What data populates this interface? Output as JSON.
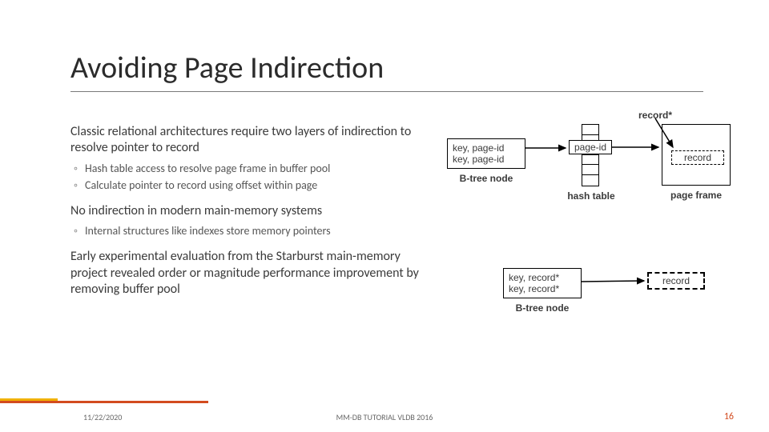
{
  "title": "Avoiding Page Indirection",
  "body": {
    "p1": "Classic relational architectures require two layers of indirection to resolve pointer to record",
    "p1_sub1": "Hash table access to resolve page frame in buffer pool",
    "p1_sub2": "Calculate pointer to record using offset within page",
    "p2": "No indirection in modern main-memory systems",
    "p2_sub1": "Internal structures like indexes store memory pointers",
    "p3": "Early experimental evaluation from the Starburst main-memory project revealed order or magnitude performance improvement by removing buffer pool"
  },
  "diagram": {
    "top": {
      "record_star": "record*",
      "btree_entry1": "key, page-id",
      "btree_entry2": "key, page-id",
      "btree_label": "B-tree node",
      "ht_special": "page-id",
      "ht_label": "hash table",
      "record_label": "record",
      "pf_label": "page frame"
    },
    "bottom": {
      "btree_entry1": "key, record*",
      "btree_entry2": "key, record*",
      "btree_label": "B-tree node",
      "record_label": "record"
    }
  },
  "footer": {
    "date": "11/22/2020",
    "source": "MM-DB TUTORIAL VLDB 2016",
    "page": "16"
  }
}
